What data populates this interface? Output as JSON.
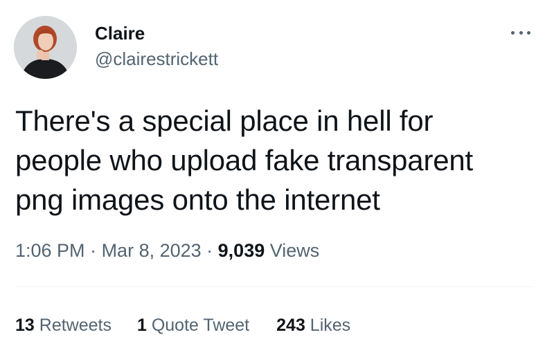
{
  "author": {
    "display_name": "Claire",
    "handle": "@clairestrickett",
    "avatar_icon": "profile-photo"
  },
  "more_icon": "more-horizontal-icon",
  "tweet": {
    "lines": [
      "There's a special place in hell for",
      "people who upload fake transparent",
      "png images onto the internet"
    ]
  },
  "meta": {
    "time": "1:06 PM",
    "separator": " · ",
    "date": "Mar 8, 2023",
    "views_count": "9,039",
    "views_label": " Views"
  },
  "stats": {
    "retweets_count": "13",
    "retweets_label": " Retweets",
    "quotes_count": "1",
    "quotes_label": " Quote Tweet",
    "likes_count": "243",
    "likes_label": " Likes"
  },
  "colors": {
    "text_primary": "#0f1419",
    "text_secondary": "#536471",
    "divider": "#eff3f4"
  }
}
